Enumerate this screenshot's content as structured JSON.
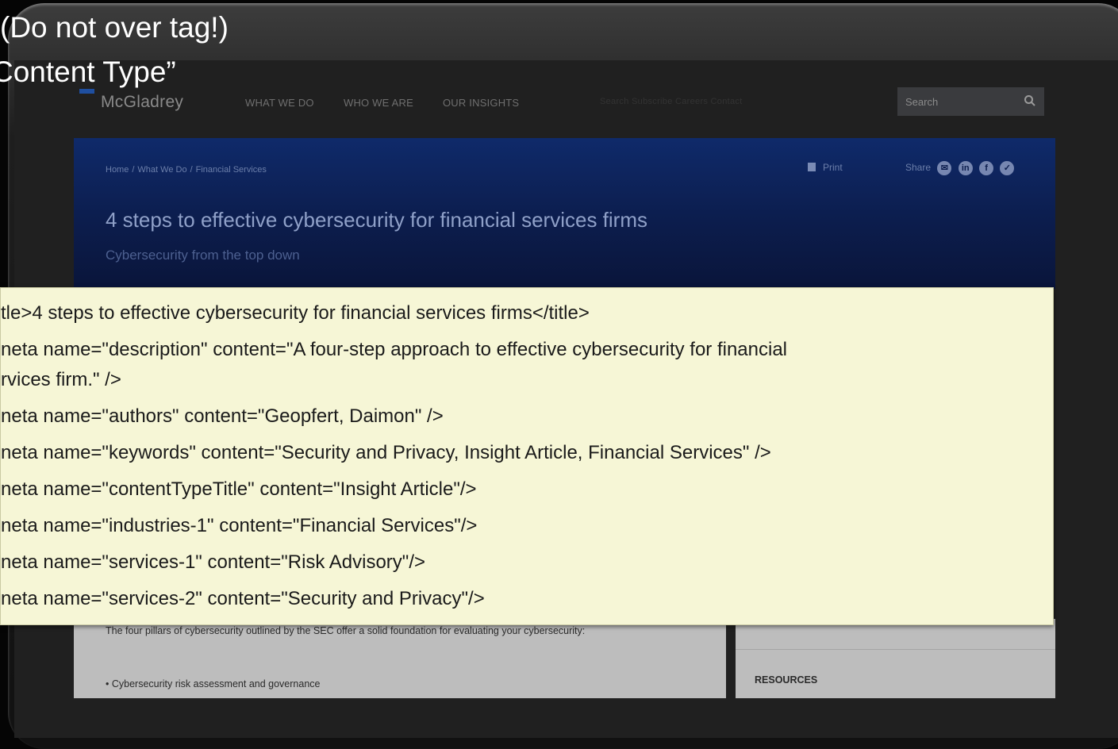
{
  "slide": {
    "line1": "(Do not over tag!)",
    "line2": "Content Type”"
  },
  "site": {
    "logo": "McGladrey",
    "nav": [
      "WHAT WE DO",
      "WHO WE ARE",
      "OUR INSIGHTS"
    ],
    "utility_links": "Search  Subscribe  Careers  Contact",
    "search_placeholder": "Search"
  },
  "hero": {
    "breadcrumb": [
      "Home",
      "What We Do",
      "Financial Services"
    ],
    "print_label": "Print",
    "share_label": "Share",
    "title": "4 steps to effective cybersecurity for financial services firms",
    "subtitle": "Cybersecurity from the top down"
  },
  "article": {
    "paragraph": "The four pillars of cybersecurity outlined by the SEC offer a solid foundation for evaluating your cybersecurity:",
    "bullet_1": "Cybersecurity risk assessment and governance"
  },
  "aside": {
    "resources_label": "RESOURCES"
  },
  "metadata": {
    "title_tag": "tle>4 steps to effective cybersecurity for financial services firms</title>",
    "description_a": "neta name=\"description\" content=\"A four-step approach to effective cybersecurity for financial",
    "description_b": "rvices firm.\" />",
    "authors": "neta name=\"authors\" content=\"Geopfert, Daimon\" />",
    "keywords": "neta name=\"keywords\" content=\"Security and Privacy, Insight Article, Financial Services\" />",
    "content_type": "neta name=\"contentTypeTitle\" content=\"Insight Article\"/>",
    "industries": "neta name=\"industries-1\" content=\"Financial Services\"/>",
    "services_1": "neta name=\"services-1\" content=\"Risk Advisory\"/>",
    "services_2": "neta name=\"services-2\" content=\"Security and Privacy\"/>"
  },
  "colors": {
    "hero_blue": "#0c1d4d",
    "overlay_bg": "#f6f6d6",
    "logo_accent": "#1f4fa0"
  }
}
